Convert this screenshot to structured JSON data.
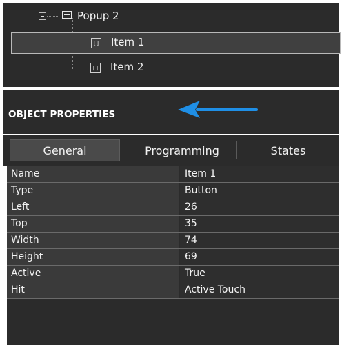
{
  "tree": {
    "items": [
      {
        "label": "Popup 2",
        "icon": "popup-icon",
        "expanded": true
      },
      {
        "label": "Item 1",
        "icon": "item-icon",
        "selected": true
      },
      {
        "label": "Item 2",
        "icon": "item-icon"
      }
    ],
    "item_icon_glyph": "[]"
  },
  "section": {
    "title": "OBJECT PROPERTIES"
  },
  "tabs": [
    {
      "label": "General",
      "active": true
    },
    {
      "label": "Programming"
    },
    {
      "label": "States"
    }
  ],
  "properties": [
    {
      "name": "Name",
      "value": "Item 1"
    },
    {
      "name": "Type",
      "value": "Button"
    },
    {
      "name": "Left",
      "value": "26"
    },
    {
      "name": "Top",
      "value": "35"
    },
    {
      "name": "Width",
      "value": "74"
    },
    {
      "name": "Height",
      "value": "69"
    },
    {
      "name": "Active",
      "value": "True"
    },
    {
      "name": "Hit",
      "value": "Active Touch"
    }
  ],
  "colors": {
    "panel_bg": "#2b2b2b",
    "arrow": "#1f8fe6",
    "text": "#f2f2f2"
  }
}
